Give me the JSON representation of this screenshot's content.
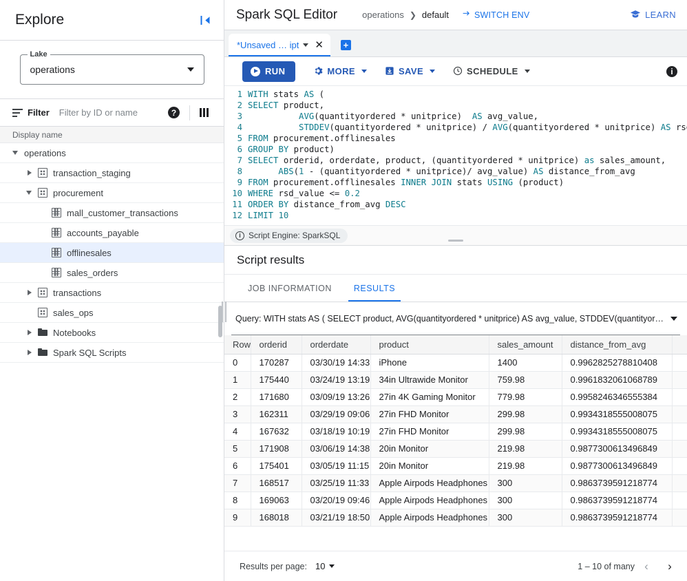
{
  "sidebar": {
    "title": "Explore",
    "collapse_icon": "collapse-panel-icon",
    "lake": {
      "legend": "Lake",
      "value": "operations"
    },
    "filter": {
      "icon": "filter-icon",
      "label": "Filter",
      "placeholder": "Filter by ID or name",
      "value": "",
      "help_icon": "help-circle-icon",
      "columns_icon": "columns-icon"
    },
    "column_header": "Display name",
    "tree": [
      {
        "label": "operations",
        "indent": 0,
        "caret": "down",
        "icon": "none",
        "selected": false
      },
      {
        "label": "transaction_staging",
        "indent": 1,
        "caret": "right",
        "icon": "db",
        "selected": false
      },
      {
        "label": "procurement",
        "indent": 1,
        "caret": "down",
        "icon": "db",
        "selected": false
      },
      {
        "label": "mall_customer_transactions",
        "indent": 2,
        "caret": "none",
        "icon": "table",
        "selected": false
      },
      {
        "label": "accounts_payable",
        "indent": 2,
        "caret": "none",
        "icon": "table",
        "selected": false
      },
      {
        "label": "offlinesales",
        "indent": 2,
        "caret": "none",
        "icon": "table",
        "selected": true
      },
      {
        "label": "sales_orders",
        "indent": 2,
        "caret": "none",
        "icon": "table",
        "selected": false
      },
      {
        "label": "transactions",
        "indent": 1,
        "caret": "right",
        "icon": "db",
        "selected": false
      },
      {
        "label": "sales_ops",
        "indent": 1,
        "caret": "none",
        "icon": "db",
        "selected": false
      },
      {
        "label": "Notebooks",
        "indent": 1,
        "caret": "right",
        "icon": "folder",
        "selected": false
      },
      {
        "label": "Spark SQL Scripts",
        "indent": 1,
        "caret": "right",
        "icon": "folder",
        "selected": false
      }
    ]
  },
  "header": {
    "title": "Spark SQL Editor",
    "breadcrumb": [
      "operations",
      "default"
    ],
    "breadcrumb_separator": "❯",
    "switch_env": {
      "label": "SWITCH ENV",
      "icon": "swap-icon"
    },
    "learn": {
      "label": "LEARN",
      "icon": "graduation-cap-icon"
    }
  },
  "tabs": {
    "items": [
      {
        "label": "*Unsaved … ipt",
        "active": true
      }
    ],
    "close_label": "✕",
    "add_label": "+"
  },
  "toolbar": {
    "run_label": "RUN",
    "more_label": "MORE",
    "save_label": "SAVE",
    "schedule_label": "SCHEDULE",
    "more_icon": "gear-icon",
    "save_icon": "save-disk-icon",
    "schedule_icon": "clock-icon",
    "info_icon": "info-icon",
    "info_glyph": "i"
  },
  "editor": {
    "lines": [
      {
        "n": "1",
        "text": "WITH stats AS ("
      },
      {
        "n": "2",
        "text": "SELECT product,"
      },
      {
        "n": "3",
        "text": "          AVG(quantityordered * unitprice)  AS avg_value,"
      },
      {
        "n": "4",
        "text": "          STDDEV(quantityordered * unitprice) / AVG(quantityordered * unitprice) AS rsd_v"
      },
      {
        "n": "5",
        "text": "FROM procurement.offlinesales"
      },
      {
        "n": "6",
        "text": "GROUP BY product)"
      },
      {
        "n": "7",
        "text": "SELECT orderid, orderdate, product, (quantityordered * unitprice) as sales_amount,"
      },
      {
        "n": "8",
        "text": "      ABS(1 - (quantityordered * unitprice)/ avg_value) AS distance_from_avg"
      },
      {
        "n": "9",
        "text": "FROM procurement.offlinesales INNER JOIN stats USING (product)"
      },
      {
        "n": "10",
        "text": "WHERE rsd_value <= 0.2"
      },
      {
        "n": "11",
        "text": "ORDER BY distance_from_avg DESC"
      },
      {
        "n": "12",
        "text": "LIMIT 10"
      }
    ]
  },
  "engine": {
    "icon": "info-circle-icon",
    "label": "Script Engine: SparkSQL"
  },
  "results": {
    "heading": "Script results",
    "tabs": [
      {
        "label": "JOB INFORMATION",
        "active": false
      },
      {
        "label": "RESULTS",
        "active": true
      }
    ],
    "query_selector": {
      "value": "Query: WITH stats AS ( SELECT product, AVG(quantityordered * unitprice) AS avg_value, STDDEV(quantityorder…"
    },
    "columns": [
      "Row",
      "orderid",
      "orderdate",
      "product",
      "sales_amount",
      "distance_from_avg",
      ""
    ],
    "rows": [
      [
        "0",
        "170287",
        "03/30/19 14:33",
        "iPhone",
        "1400",
        "0.9962825278810408",
        ""
      ],
      [
        "1",
        "175440",
        "03/24/19 13:19",
        "34in Ultrawide Monitor",
        "759.98",
        "0.9961832061068789",
        ""
      ],
      [
        "2",
        "171680",
        "03/09/19 13:26",
        "27in 4K Gaming Monitor",
        "779.98",
        "0.9958246346555384",
        ""
      ],
      [
        "3",
        "162311",
        "03/29/19 09:06",
        "27in FHD Monitor",
        "299.98",
        "0.9934318555008075",
        ""
      ],
      [
        "4",
        "167632",
        "03/18/19 10:19",
        "27in FHD Monitor",
        "299.98",
        "0.9934318555008075",
        ""
      ],
      [
        "5",
        "171908",
        "03/06/19 14:38",
        "20in Monitor",
        "219.98",
        "0.9877300613496849",
        ""
      ],
      [
        "6",
        "175401",
        "03/05/19 11:15",
        "20in Monitor",
        "219.98",
        "0.9877300613496849",
        ""
      ],
      [
        "7",
        "168517",
        "03/25/19 11:33",
        "Apple Airpods Headphones",
        "300",
        "0.9863739591218774",
        ""
      ],
      [
        "8",
        "169063",
        "03/20/19 09:46",
        "Apple Airpods Headphones",
        "300",
        "0.9863739591218774",
        ""
      ],
      [
        "9",
        "168018",
        "03/21/19 18:50",
        "Apple Airpods Headphones",
        "300",
        "0.9863739591218774",
        ""
      ]
    ]
  },
  "footer": {
    "per_page_label": "Results per page:",
    "per_page_value": "10",
    "range": "1 – 10 of many",
    "prev_glyph": "‹",
    "next_glyph": "›"
  },
  "colors": {
    "accent": "#1a73e8",
    "run": "#2559b5",
    "selected_row": "#e8f0fe",
    "keyword": "#0c7b8c"
  }
}
